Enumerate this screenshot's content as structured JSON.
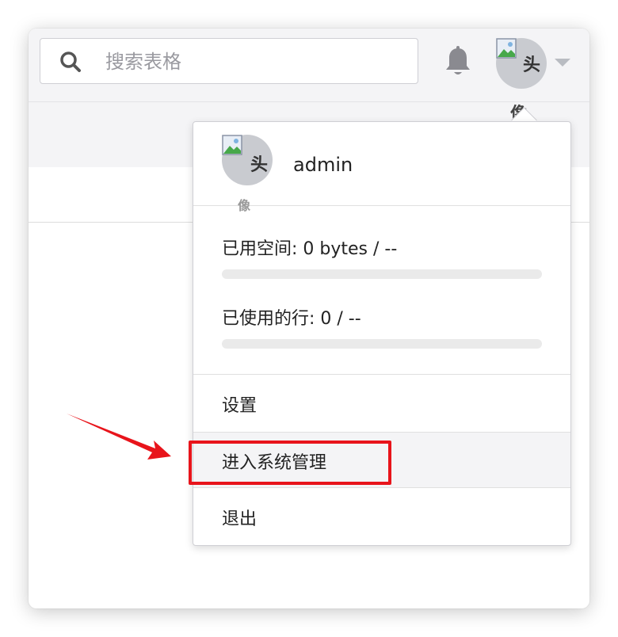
{
  "search": {
    "placeholder": "搜索表格"
  },
  "header": {
    "avatar_alt": "头像",
    "avatar_alt_line1": "头",
    "avatar_alt_line2": "像"
  },
  "user_menu": {
    "username": "admin",
    "avatar_alt_line1": "头",
    "avatar_alt_line2": "像",
    "space_used_label": "已用空间: 0 bytes / --",
    "space_used_fraction": 0,
    "rows_used_label": "已使用的行: 0 / --",
    "rows_used_fraction": 0,
    "items": [
      {
        "label": "设置"
      },
      {
        "label": "进入系统管理"
      },
      {
        "label": "退出"
      }
    ]
  },
  "colors": {
    "annotation": "#e8141b",
    "progress_track": "#eaeaea"
  }
}
